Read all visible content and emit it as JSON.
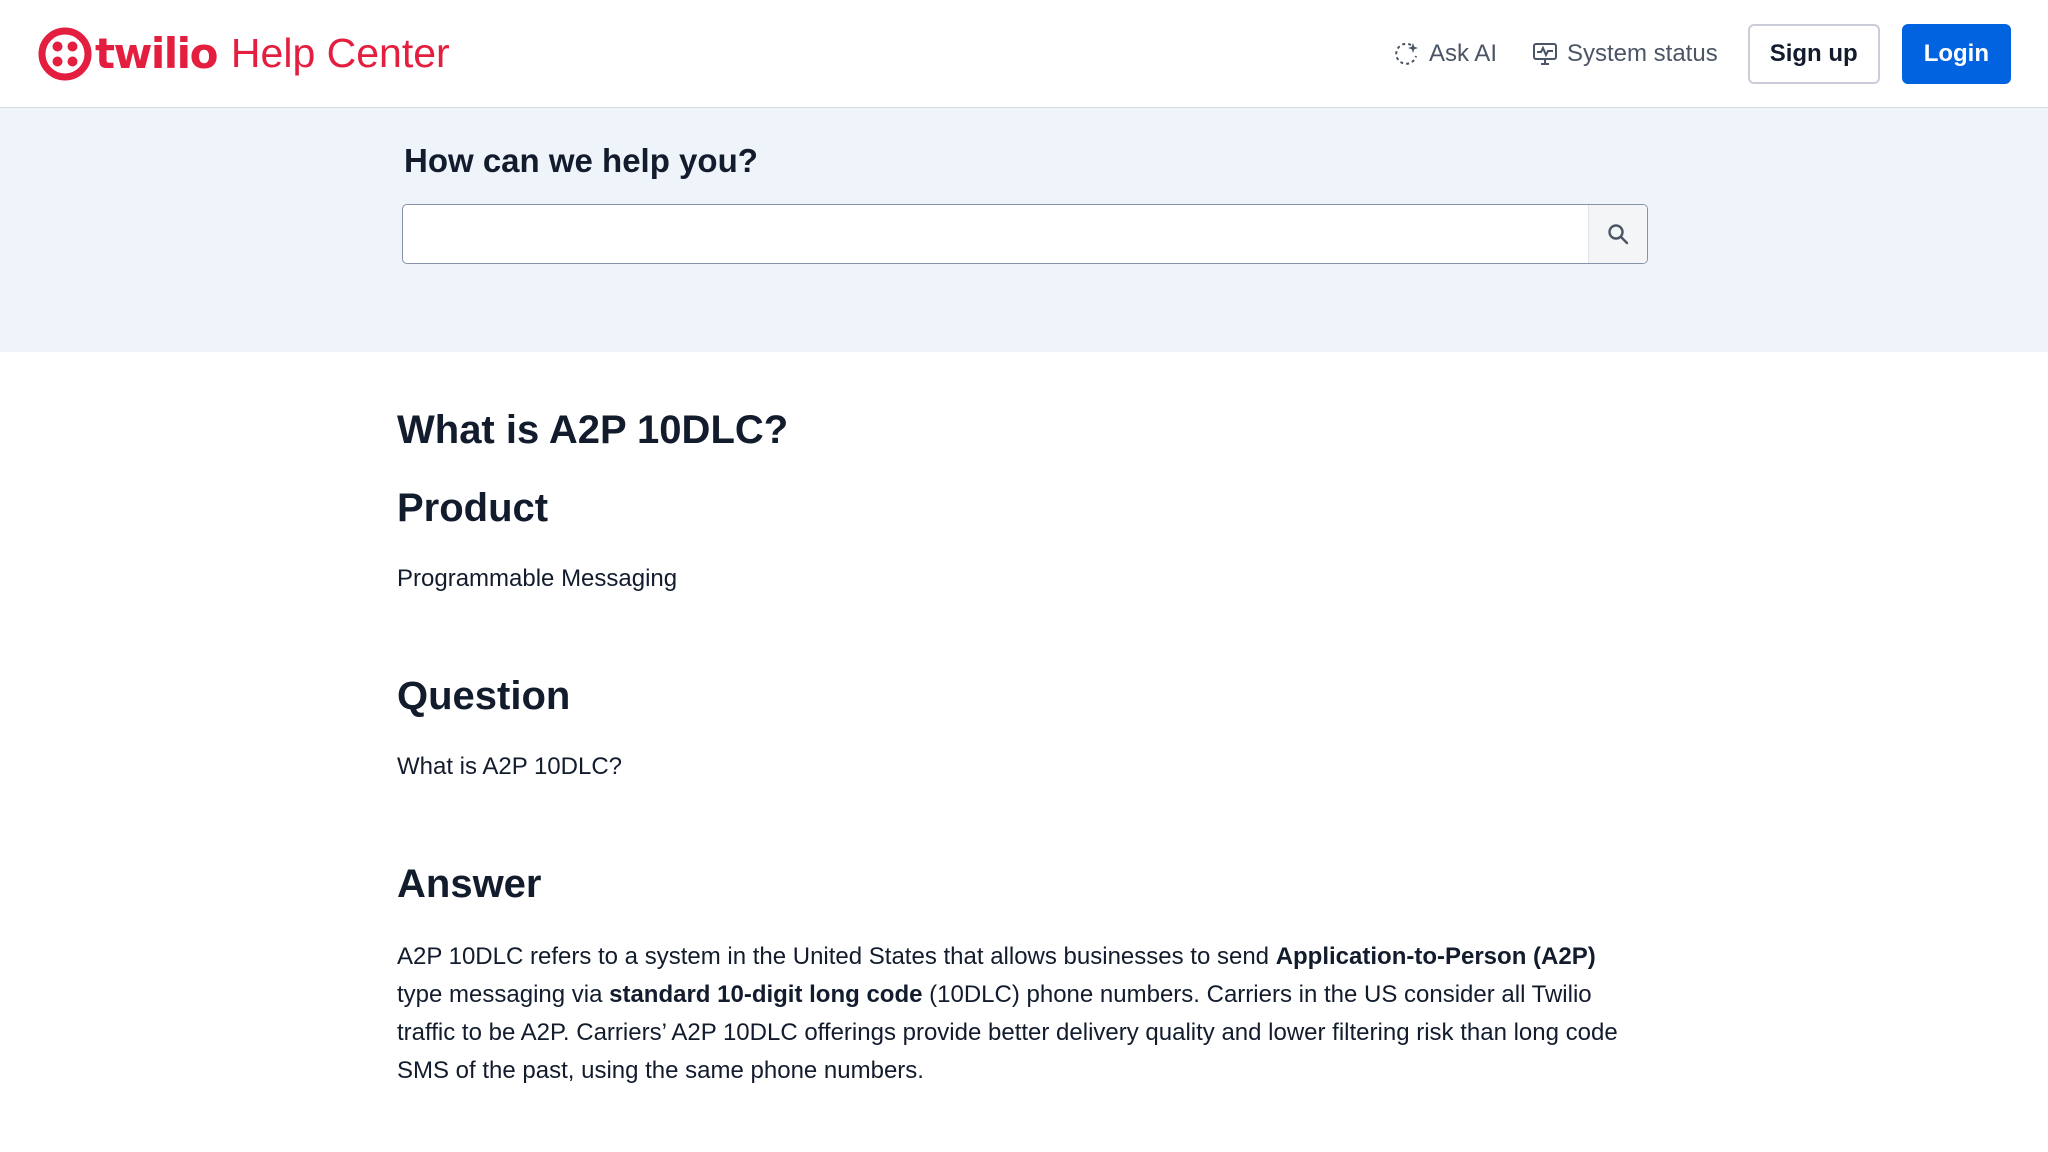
{
  "header": {
    "logo_text": "twilio",
    "brand_sub": "Help Center",
    "ask_ai": "Ask AI",
    "system_status": "System status",
    "signup": "Sign up",
    "login": "Login"
  },
  "search": {
    "title": "How can we help you?",
    "value": "",
    "placeholder": ""
  },
  "article": {
    "title": "What is A2P 10DLC?",
    "product_heading": "Product",
    "product_text": "Programmable Messaging",
    "question_heading": "Question",
    "question_text": "What is A2P 10DLC?",
    "answer_heading": "Answer",
    "answer_parts": {
      "p1": "A2P 10DLC refers to a system in the United States that allows businesses to send ",
      "b1": "Application-to-Person (A2P)",
      "p2": " type messaging via ",
      "b2": "standard 10-digit long code",
      "p3": " (10DLC) phone numbers. Carriers in the US consider all Twilio traffic to be A2P. Carriers’ A2P 10DLC offerings provide better delivery quality and lower filtering risk than long code SMS of the past, using the same phone numbers."
    }
  },
  "colors": {
    "brand_red": "#e31e3f",
    "primary_blue": "#0263e0",
    "search_band": "#eff4fb"
  },
  "icons": {
    "logo": "twilio-logo-icon",
    "ask_ai": "sparkle-icon",
    "system_status": "monitor-pulse-icon",
    "search": "search-icon"
  }
}
